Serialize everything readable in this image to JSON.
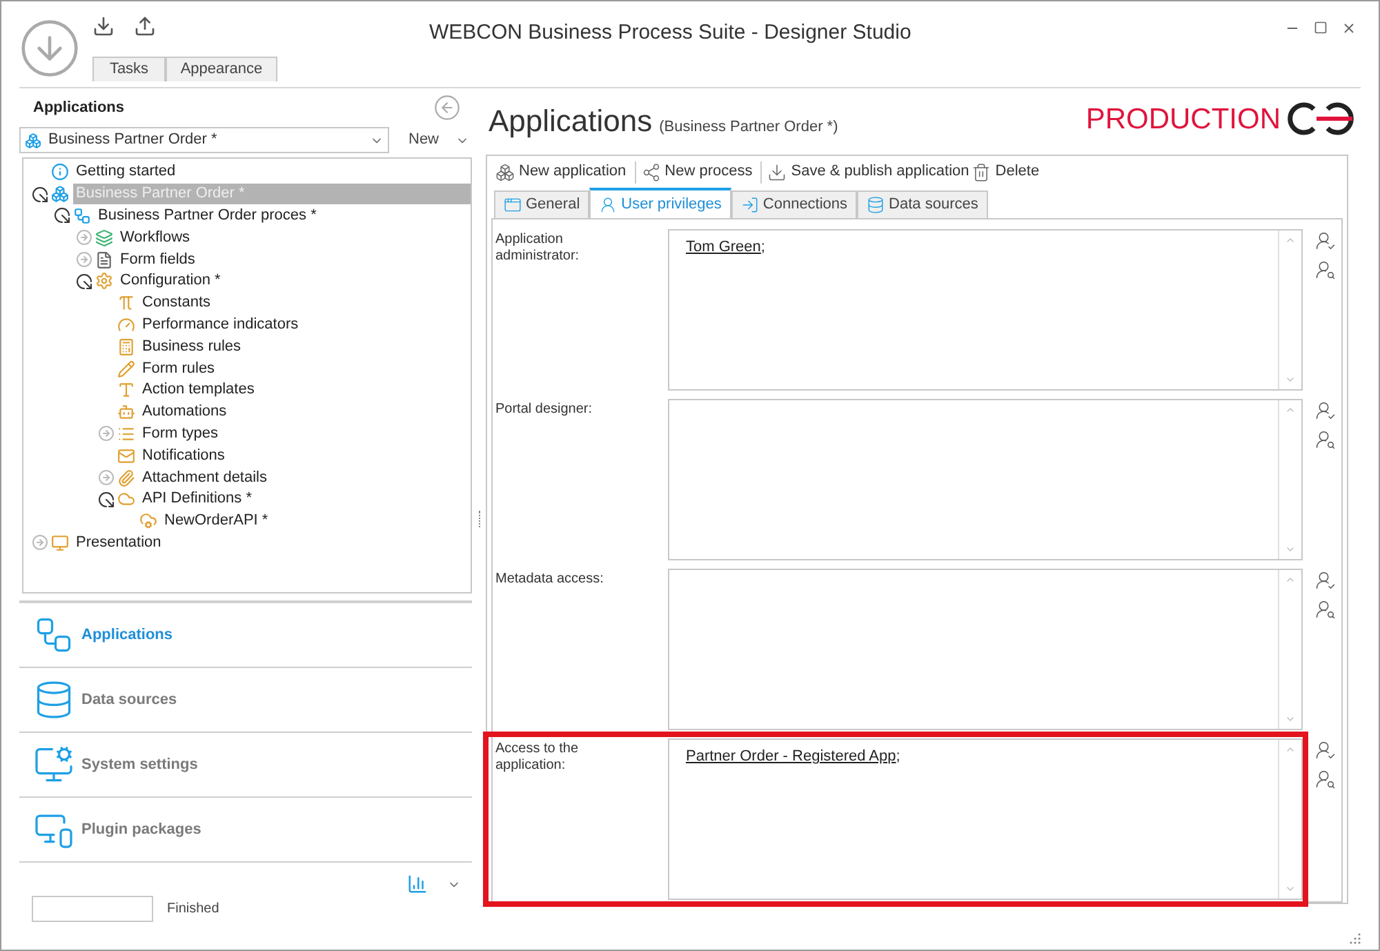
{
  "window": {
    "title": "WEBCON Business Process Suite - Designer Studio"
  },
  "ribbon_tabs": [
    {
      "label": "Tasks",
      "selected": false
    },
    {
      "label": "Appearance",
      "selected": false
    }
  ],
  "left_panel": {
    "title": "Applications",
    "app_selector": {
      "value": "Business Partner Order *"
    },
    "new_button": "New",
    "tree": [
      {
        "label": "Getting started",
        "selected": false
      },
      {
        "label": "Business Partner Order *",
        "selected": true,
        "expanded": true,
        "children": [
          {
            "label": "Business Partner Order proces *",
            "selected": false,
            "expanded": true,
            "children": [
              {
                "label": "Workflows",
                "selected": false,
                "expanded": false
              },
              {
                "label": "Form fields",
                "selected": false,
                "expanded": false
              },
              {
                "label": "Configuration *",
                "selected": false,
                "expanded": true,
                "children": [
                  {
                    "label": "Constants",
                    "selected": false
                  },
                  {
                    "label": "Performance indicators",
                    "selected": false
                  },
                  {
                    "label": "Business rules",
                    "selected": false
                  },
                  {
                    "label": "Form rules",
                    "selected": false
                  },
                  {
                    "label": "Action templates",
                    "selected": false
                  },
                  {
                    "label": "Automations",
                    "selected": false
                  },
                  {
                    "label": "Form types",
                    "selected": false,
                    "expanded": false
                  },
                  {
                    "label": "Notifications",
                    "selected": false
                  },
                  {
                    "label": "Attachment details",
                    "selected": false,
                    "expanded": false
                  },
                  {
                    "label": "API Definitions *",
                    "selected": false,
                    "expanded": true,
                    "children": [
                      {
                        "label": "NewOrderAPI *",
                        "selected": false
                      }
                    ]
                  }
                ]
              }
            ]
          }
        ]
      },
      {
        "label": "Presentation",
        "selected": false,
        "expanded": false
      }
    ],
    "nav": [
      {
        "label": "Applications",
        "selected": true
      },
      {
        "label": "Data sources",
        "selected": false
      },
      {
        "label": "System settings",
        "selected": false
      },
      {
        "label": "Plugin packages",
        "selected": false
      }
    ],
    "status": "Finished"
  },
  "main": {
    "title": "Applications",
    "subtitle": "(Business Partner Order *)",
    "environment": "PRODUCTION",
    "toolbar": [
      "New application",
      "New process",
      "Save & publish application",
      "Delete"
    ],
    "tabs": [
      {
        "label": "General",
        "selected": false
      },
      {
        "label": "User privileges",
        "selected": true
      },
      {
        "label": "Connections",
        "selected": false
      },
      {
        "label": "Data sources",
        "selected": false
      }
    ],
    "fields": [
      {
        "label": "Application administrator:",
        "highlighted": false,
        "entries": [
          {
            "name": "Tom Green",
            "separator": ";"
          }
        ]
      },
      {
        "label": "Portal designer:",
        "highlighted": false
      },
      {
        "label": "Metadata access:",
        "highlighted": false
      },
      {
        "label": "Access to the application:",
        "highlighted": true,
        "entries": [
          {
            "name": "Partner Order - Registered App",
            "separator": ";"
          }
        ]
      }
    ]
  }
}
